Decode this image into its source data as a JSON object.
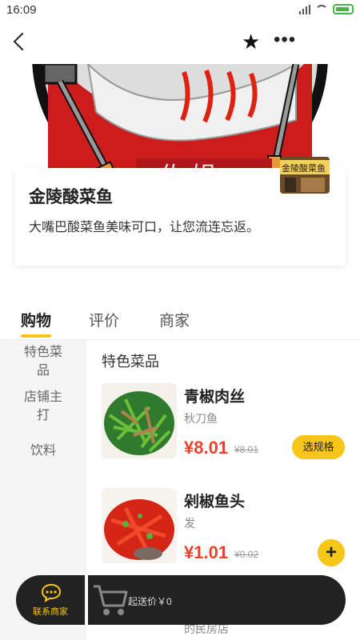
{
  "status": {
    "time": "16:09"
  },
  "nav": {
    "back_icon": "chevron-left-icon",
    "favorite_icon": "star-icon",
    "more_icon": "more-dots-icon"
  },
  "shop": {
    "name": "金陵酸菜鱼",
    "description": "大嘴巴酸菜鱼美味可口，让您流连忘返。",
    "banner_sign_text": "金陵酸菜鱼"
  },
  "tabs": [
    {
      "label": "购物",
      "active": true
    },
    {
      "label": "评价",
      "active": false
    },
    {
      "label": "商家",
      "active": false
    }
  ],
  "categories": [
    {
      "line1": "特色菜",
      "line2": "品"
    },
    {
      "line1": "店铺主",
      "line2": "打"
    },
    {
      "line1": "饮料",
      "line2": ""
    }
  ],
  "section_title": "特色菜品",
  "products": [
    {
      "name": "青椒肉丝",
      "subtitle": "秋刀鱼",
      "price": "¥8.01",
      "original_price": "¥8.01",
      "action": "选规格"
    },
    {
      "name": "剁椒鱼头",
      "subtitle": "发",
      "price": "¥1.01",
      "original_price": "¥0.02",
      "action": "+"
    }
  ],
  "next_item_peek": "的民房店",
  "bottom_bar": {
    "contact_label": "联系商家",
    "cart_text": "起送价￥0"
  },
  "colors": {
    "accent": "#f5c518",
    "price": "#e8432e",
    "bar": "#222222"
  }
}
